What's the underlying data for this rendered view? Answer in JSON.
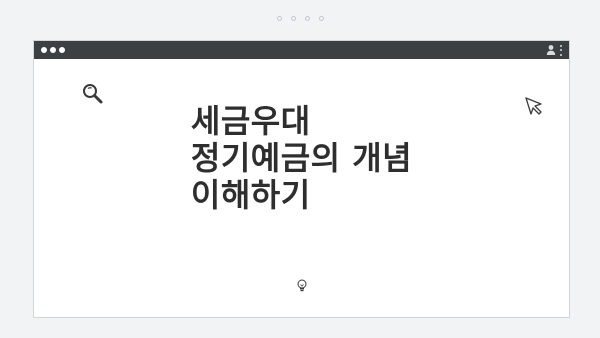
{
  "headline": {
    "lines": [
      "세금우대",
      "정기예금의 개념",
      "이해하기"
    ]
  },
  "icons": {
    "search": "search-icon",
    "cursor": "cursor-icon",
    "bulb": "lightbulb-icon",
    "avatar": "avatar-icon",
    "menu": "kebab-menu-icon"
  },
  "colors": {
    "background": "#f1f3f5",
    "titlebar": "#3c4043",
    "window": "#ffffff",
    "text": "#2e2e2e"
  }
}
